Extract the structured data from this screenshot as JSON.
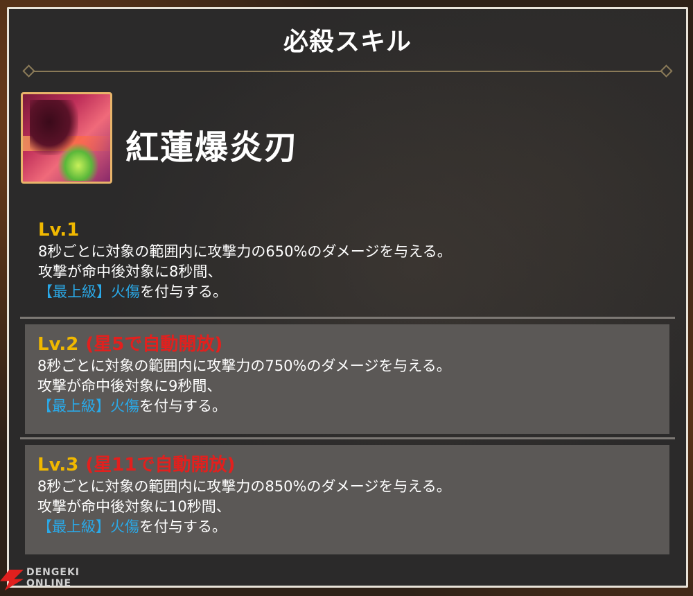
{
  "panel": {
    "title": "必殺スキル"
  },
  "skill": {
    "icon": "skill-portrait-icon",
    "name": "紅蓮爆炎刃"
  },
  "levels": [
    {
      "label": "Lv.1",
      "unlock": "",
      "line1": "8秒ごとに対象の範囲内に攻撃力の650%のダメージを与える。",
      "line2": "攻撃が命中後対象に8秒間、",
      "tag": "【最上級】",
      "effect": "火傷",
      "suffix": "を付与する。"
    },
    {
      "label": "Lv.2",
      "unlock": "(星5で自動開放)",
      "line1": "8秒ごとに対象の範囲内に攻撃力の750%のダメージを与える。",
      "line2": "攻撃が命中後対象に9秒間、",
      "tag": "【最上級】",
      "effect": "火傷",
      "suffix": "を付与する。"
    },
    {
      "label": "Lv.3",
      "unlock": "(星11で自動開放)",
      "line1": "8秒ごとに対象の範囲内に攻撃力の850%のダメージを与える。",
      "line2": "攻撃が命中後対象に10秒間、",
      "tag": "【最上級】",
      "effect": "火傷",
      "suffix": "を付与する。"
    }
  ],
  "watermark": {
    "line1": "DENGEKI",
    "line2": "ONLINE"
  },
  "colors": {
    "level_label": "#f0b800",
    "unlock_text": "#e2201e",
    "keyword": "#2aa9e8",
    "panel_bg": "#2b2a2a",
    "box_bg": "#5b5856"
  }
}
